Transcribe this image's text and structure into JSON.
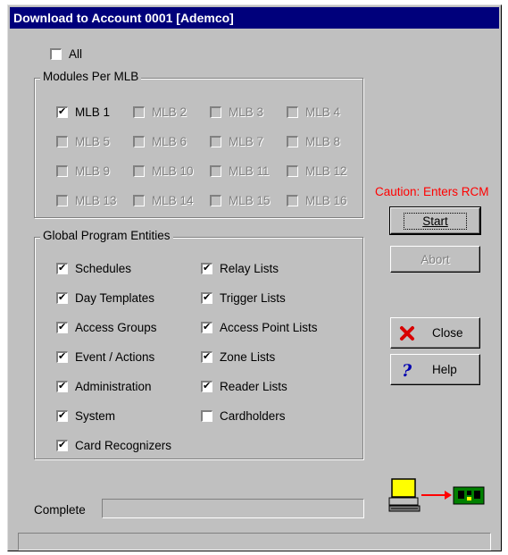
{
  "window": {
    "title": "Download to Account 0001 [Ademco]"
  },
  "all_checkbox": {
    "label": "All",
    "checked": false
  },
  "modules": {
    "legend": "Modules Per MLB",
    "items": [
      {
        "label": "MLB 1",
        "checked": true,
        "enabled": true
      },
      {
        "label": "MLB 2",
        "checked": false,
        "enabled": false
      },
      {
        "label": "MLB 3",
        "checked": false,
        "enabled": false
      },
      {
        "label": "MLB 4",
        "checked": false,
        "enabled": false
      },
      {
        "label": "MLB 5",
        "checked": false,
        "enabled": false
      },
      {
        "label": "MLB 6",
        "checked": false,
        "enabled": false
      },
      {
        "label": "MLB 7",
        "checked": false,
        "enabled": false
      },
      {
        "label": "MLB 8",
        "checked": false,
        "enabled": false
      },
      {
        "label": "MLB 9",
        "checked": false,
        "enabled": false
      },
      {
        "label": "MLB 10",
        "checked": false,
        "enabled": false
      },
      {
        "label": "MLB 11",
        "checked": false,
        "enabled": false
      },
      {
        "label": "MLB 12",
        "checked": false,
        "enabled": false
      },
      {
        "label": "MLB 13",
        "checked": false,
        "enabled": false
      },
      {
        "label": "MLB 14",
        "checked": false,
        "enabled": false
      },
      {
        "label": "MLB 15",
        "checked": false,
        "enabled": false
      },
      {
        "label": "MLB 16",
        "checked": false,
        "enabled": false
      }
    ]
  },
  "entities": {
    "legend": "Global Program Entities",
    "left": [
      {
        "label": "Schedules",
        "checked": true
      },
      {
        "label": "Day Templates",
        "checked": true
      },
      {
        "label": "Access Groups",
        "checked": true
      },
      {
        "label": "Event / Actions",
        "checked": true
      },
      {
        "label": "Administration",
        "checked": true
      },
      {
        "label": "System",
        "checked": true
      },
      {
        "label": "Card Recognizers",
        "checked": true
      }
    ],
    "right": [
      {
        "label": "Relay Lists",
        "checked": true
      },
      {
        "label": "Trigger Lists",
        "checked": true
      },
      {
        "label": "Access Point Lists",
        "checked": true
      },
      {
        "label": "Zone Lists",
        "checked": true
      },
      {
        "label": "Reader Lists",
        "checked": true
      },
      {
        "label": "Cardholders",
        "checked": false
      }
    ]
  },
  "caution": "Caution: Enters RCM",
  "buttons": {
    "start": "Start",
    "abort": "Abort",
    "close": "Close",
    "help": "Help"
  },
  "icons": {
    "close": "red-x-icon",
    "help": "question-mark-icon",
    "download": "computer-to-board-icon"
  },
  "colors": {
    "title_bg": "#00007b",
    "caution": "#ff0000",
    "face": "#c0c0c0"
  },
  "progress": {
    "label": "Complete",
    "value": 0
  },
  "status_bar": {
    "text": ""
  }
}
